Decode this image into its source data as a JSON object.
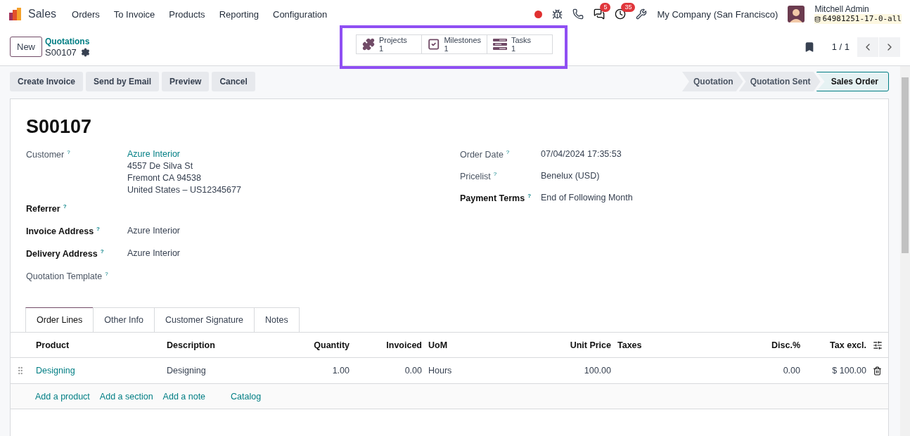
{
  "navbar": {
    "app_name": "Sales",
    "menu": [
      "Orders",
      "To Invoice",
      "Products",
      "Reporting",
      "Configuration"
    ],
    "systray": {
      "messages_badge": "5",
      "activities_badge": "35",
      "company": "My Company (San Francisco)",
      "user_name": "Mitchell Admin",
      "database": "64981251-17-0-all"
    }
  },
  "control_panel": {
    "new_button": "New",
    "breadcrumb_parent": "Quotations",
    "breadcrumb_current": "S00107",
    "smart_buttons": [
      {
        "kind": "projects",
        "label": "Projects",
        "count": "1"
      },
      {
        "kind": "milestones",
        "label": "Milestones",
        "count": "1"
      },
      {
        "kind": "tasks",
        "label": "Tasks",
        "count": "1"
      }
    ],
    "pager": "1 / 1"
  },
  "action_buttons": [
    "Create Invoice",
    "Send by Email",
    "Preview",
    "Cancel"
  ],
  "stages": [
    {
      "label": "Quotation",
      "selected": false
    },
    {
      "label": "Quotation Sent",
      "selected": false
    },
    {
      "label": "Sales Order",
      "selected": true
    }
  ],
  "record": {
    "title": "S00107",
    "left_fields": [
      {
        "label": "Customer",
        "help": "?",
        "required": false,
        "link": "Azure Interior",
        "lines": [
          "4557 De Silva St",
          "Fremont CA 94538",
          "United States – US12345677"
        ]
      },
      {
        "label": "Referrer",
        "help": "?",
        "required": true
      },
      {
        "label": "Invoice Address",
        "help": "?",
        "required": true,
        "lines": [
          "Azure Interior"
        ]
      },
      {
        "label": "Delivery Address",
        "help": "?",
        "required": true,
        "lines": [
          "Azure Interior"
        ]
      },
      {
        "label": "Quotation Template",
        "help": "?",
        "required": false
      }
    ],
    "right_fields": [
      {
        "label": "Order Date",
        "help": "?",
        "required": false,
        "lines": [
          "07/04/2024 17:35:53"
        ]
      },
      {
        "label": "Pricelist",
        "help": "?",
        "required": false,
        "lines": [
          "Benelux (USD)"
        ]
      },
      {
        "label": "Payment Terms",
        "help": "?",
        "required": true,
        "lines": [
          "End of Following Month"
        ]
      }
    ]
  },
  "tabs": [
    {
      "label": "Order Lines",
      "selected": true
    },
    {
      "label": "Other Info",
      "selected": false
    },
    {
      "label": "Customer Signature",
      "selected": false
    },
    {
      "label": "Notes",
      "selected": false
    }
  ],
  "order_lines": {
    "columns": [
      {
        "label": "Product",
        "kind": "text"
      },
      {
        "label": "Description",
        "kind": "text"
      },
      {
        "label": "Quantity",
        "kind": "number"
      },
      {
        "label": "Invoiced",
        "kind": "number"
      },
      {
        "label": "UoM",
        "kind": "text"
      },
      {
        "label": "Unit Price",
        "kind": "number"
      },
      {
        "label": "Taxes",
        "kind": "text"
      },
      {
        "label": "Disc.%",
        "kind": "number"
      },
      {
        "label": "Tax excl.",
        "kind": "number"
      }
    ],
    "rows": [
      {
        "cells": [
          "Designing",
          "Designing",
          "1.00",
          "0.00",
          "Hours",
          "100.00",
          null,
          "0.00",
          "$ 100.00"
        ]
      }
    ],
    "add_links": [
      "Add a product",
      "Add a section",
      "Add a note",
      "Catalog"
    ]
  }
}
